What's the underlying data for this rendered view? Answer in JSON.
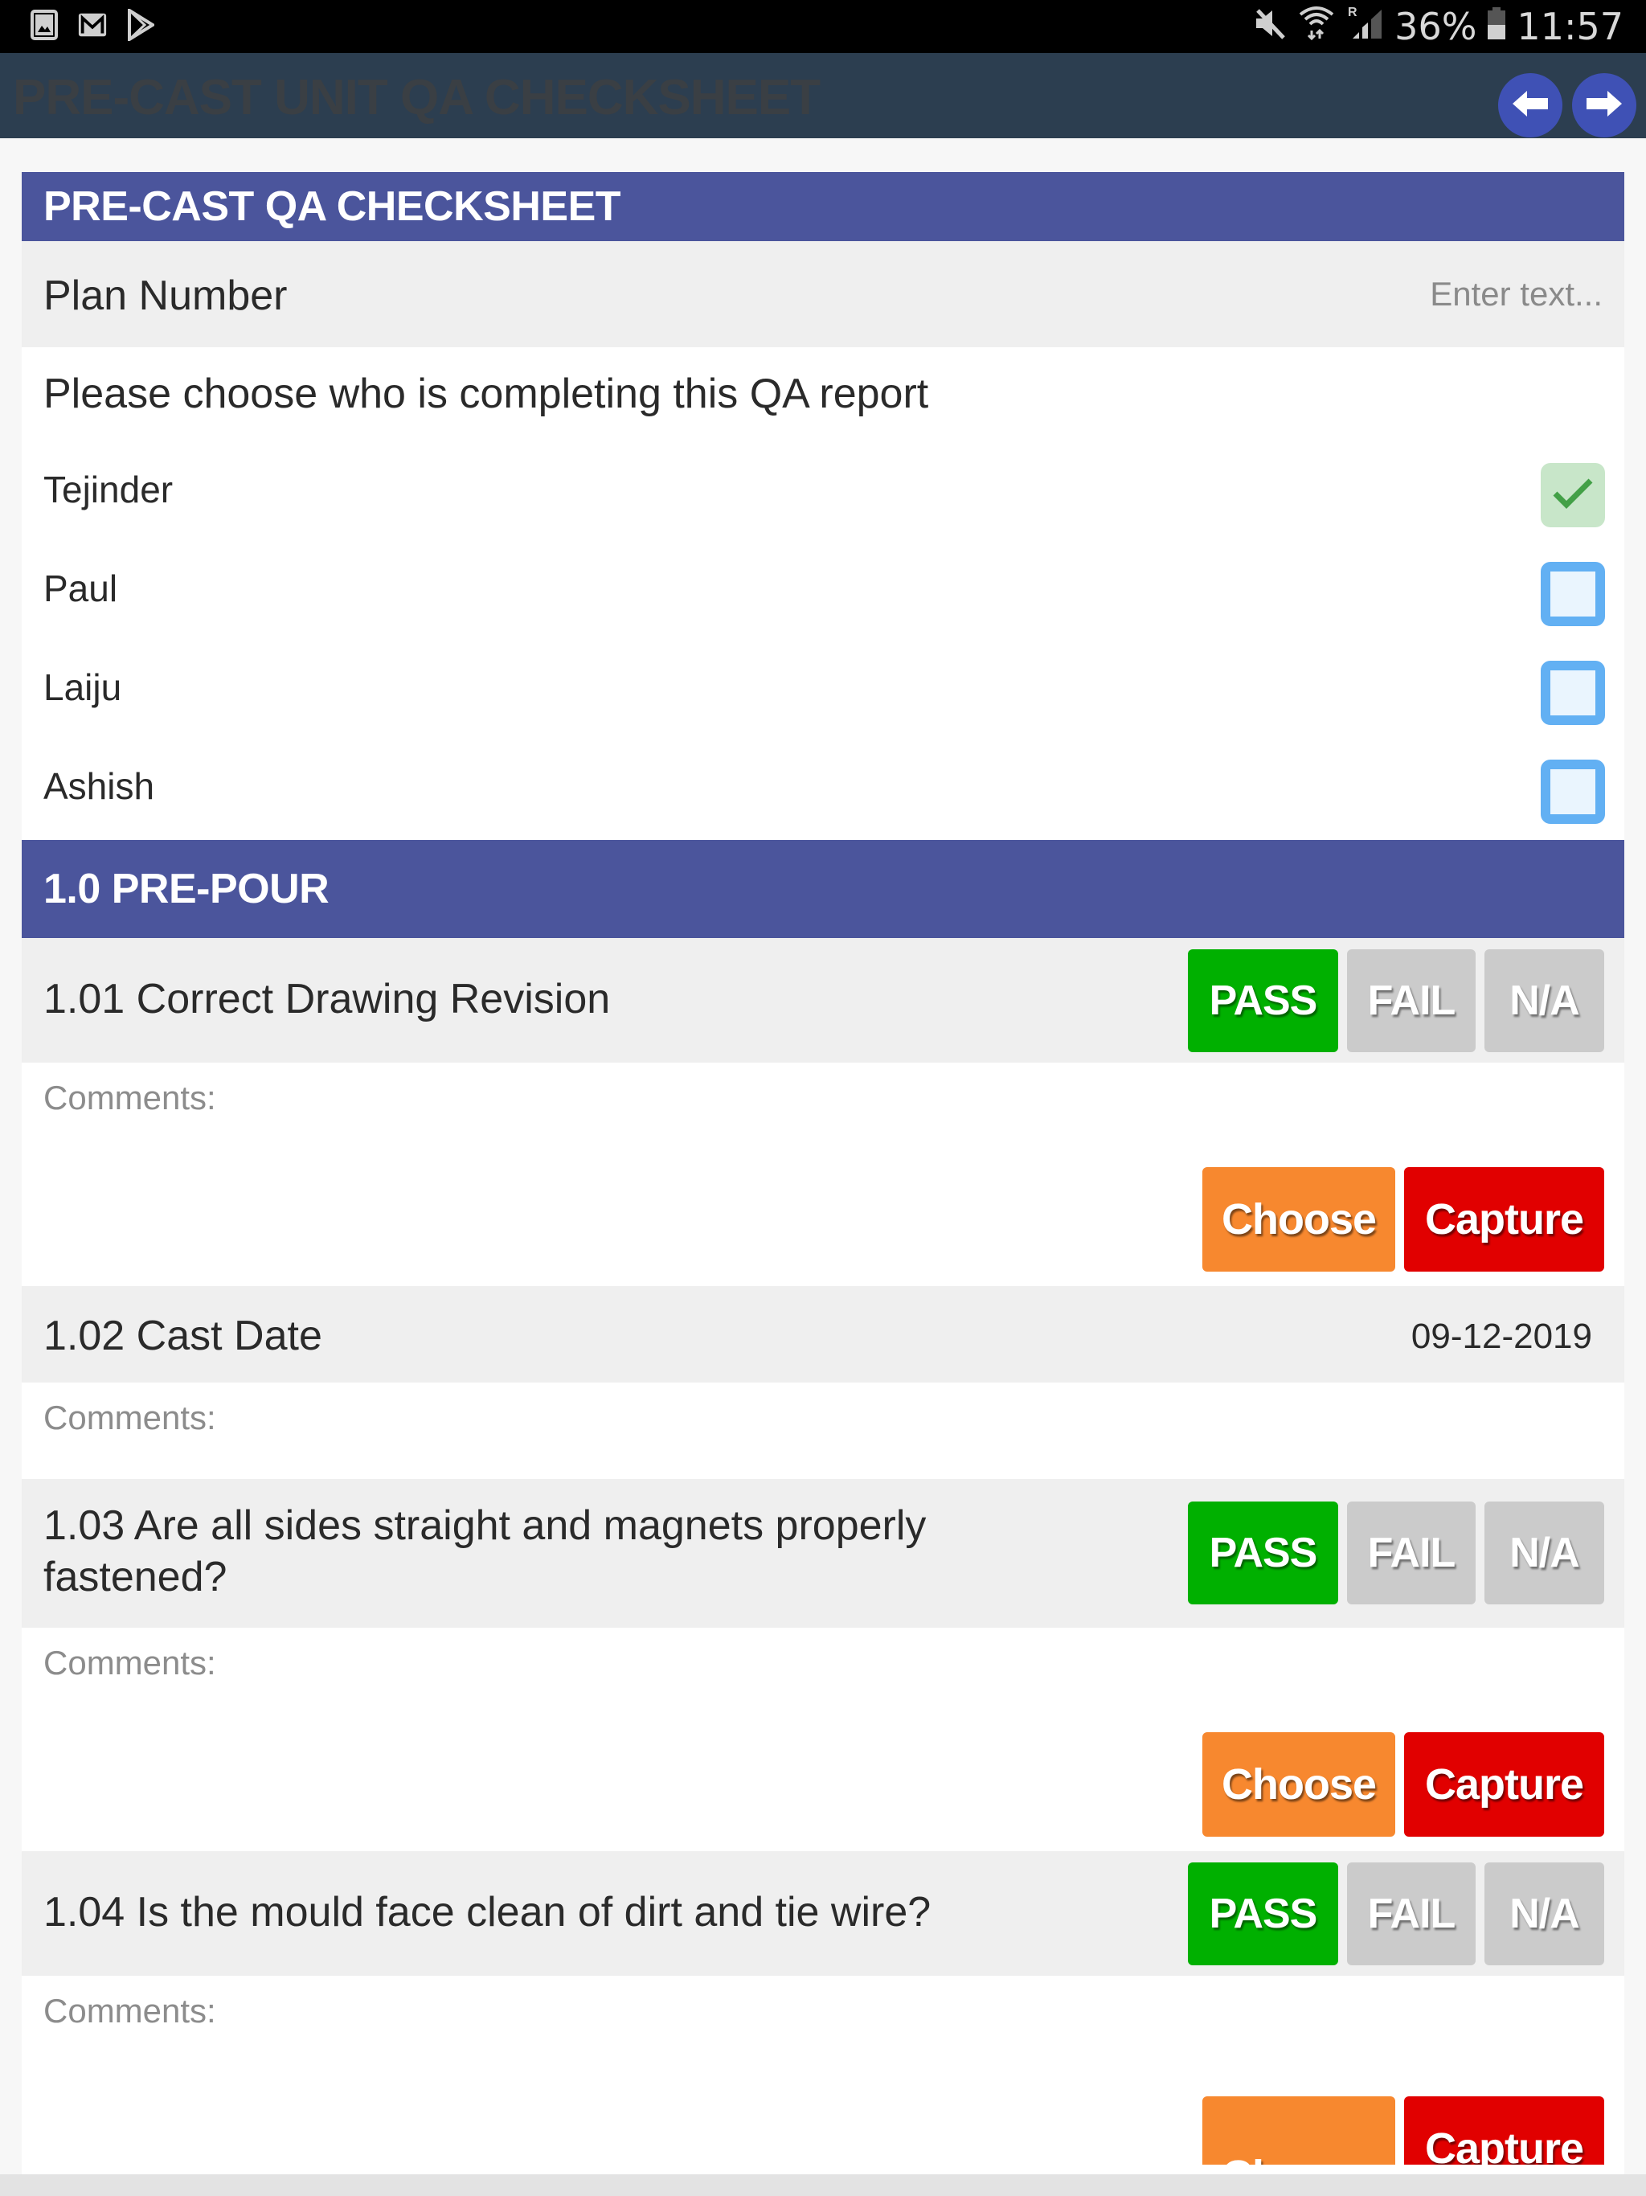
{
  "status_bar": {
    "left_icons": [
      "gallery-icon",
      "gmail-icon",
      "play-store-icon"
    ],
    "right_icons": [
      "mute-icon",
      "wifi-icon",
      "signal-roaming-icon"
    ],
    "battery_percent": "36%",
    "time": "11:57"
  },
  "app_bar": {
    "title": "PRE-CAST UNIT QA CHECKSHEET",
    "back_icon": "arrow-left-icon",
    "forward_icon": "arrow-right-icon"
  },
  "form": {
    "header": "PRE-CAST QA CHECKSHEET",
    "plan_number": {
      "label": "Plan Number",
      "value": "",
      "placeholder": "Enter text..."
    },
    "completer": {
      "question": "Please choose who is completing this QA report",
      "options": [
        {
          "name": "Tejinder",
          "checked": true
        },
        {
          "name": "Paul",
          "checked": false
        },
        {
          "name": "Laiju",
          "checked": false
        },
        {
          "name": "Ashish",
          "checked": false
        }
      ]
    },
    "sections": [
      {
        "title": "1.0 PRE-POUR",
        "items": [
          {
            "label": "1.01 Correct Drawing Revision",
            "type": "pass_fail",
            "selected": "PASS",
            "comments_label": "Comments:",
            "choose_label": "Choose",
            "capture_label": "Capture"
          },
          {
            "label": "1.02 Cast Date",
            "type": "date",
            "value": "09-12-2019",
            "comments_label": "Comments:"
          },
          {
            "label": "1.03 Are all sides straight and magnets properly fastened?",
            "type": "pass_fail",
            "selected": "PASS",
            "comments_label": "Comments:",
            "choose_label": "Choose",
            "capture_label": "Capture"
          },
          {
            "label": "1.04 Is the mould face clean of dirt and tie wire?",
            "type": "pass_fail",
            "selected": "PASS",
            "comments_label": "Comments:",
            "choose_label": "Choose",
            "capture_label": "Capture"
          }
        ]
      }
    ],
    "result_options": {
      "pass": "PASS",
      "fail": "FAIL",
      "na": "N/A"
    }
  },
  "colors": {
    "app_bar": "#2c3e50",
    "section_header": "#4b559c",
    "pass_selected": "#00b000",
    "unselected": "#cbcbcb",
    "choose": "#f7882f",
    "capture": "#e10000",
    "nav_button": "#3f51b5"
  }
}
